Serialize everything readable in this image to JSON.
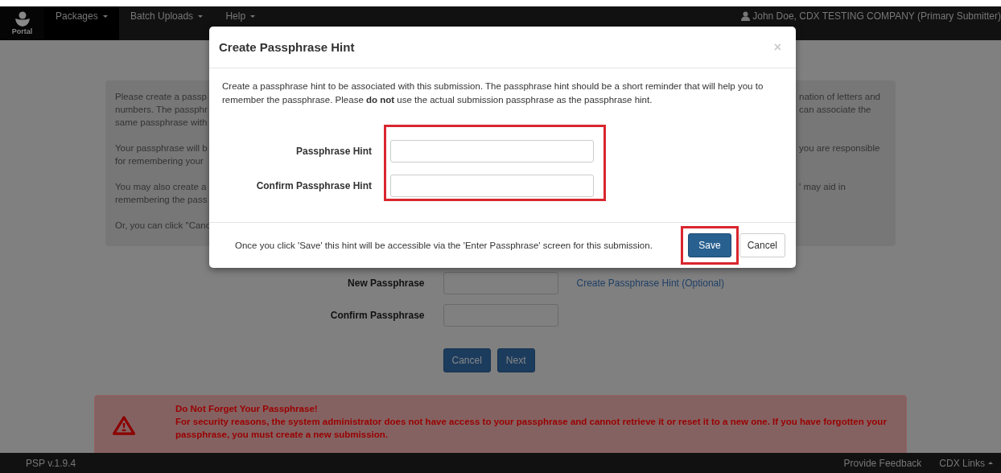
{
  "navbar": {
    "logo_text": "Portal",
    "menus": [
      {
        "label": "Packages",
        "selected": true
      },
      {
        "label": "Batch Uploads",
        "selected": false
      },
      {
        "label": "Help",
        "selected": false
      }
    ],
    "user": "John Doe, CDX TESTING COMPANY (Primary Submitter)"
  },
  "info_panel": {
    "paragraphs": [
      [
        {
          "left": "Please create a passp",
          "right": "nation of letters and"
        },
        {
          "left": "numbers. The passphr",
          "right": "can associate the"
        },
        {
          "left": "same passphrase with"
        }
      ],
      [
        {
          "left": "Your passphrase will b",
          "right": "you are responsible"
        },
        {
          "left": "for remembering your"
        }
      ],
      [
        {
          "left": "You may also create a",
          "right": "' may aid in"
        },
        {
          "left": "remembering the pass"
        }
      ],
      [
        {
          "left": "Or, you can click \"Canc"
        }
      ]
    ]
  },
  "form": {
    "fields": [
      {
        "label": "New Passphrase",
        "link": "Create Passphrase Hint (Optional)"
      },
      {
        "label": "Confirm Passphrase"
      }
    ],
    "buttons": [
      "Cancel",
      "Next"
    ]
  },
  "alert": {
    "title": "Do Not Forget Your Passphrase!",
    "text": "For security reasons, the system administrator does not have access to your passphrase and cannot retrieve it or reset it to a new one. If you have forgotten your passphrase, you must create a new submission."
  },
  "footer": {
    "version": "PSP v.1.9.4",
    "links": [
      {
        "label": "Provide Feedback",
        "caret": false
      },
      {
        "label": "CDX Links",
        "caret": true
      }
    ]
  },
  "modal": {
    "title": "Create Passphrase Hint",
    "close": "×",
    "intro": "Create a passphrase hint to be associated with this submission. The passphrase hint should be a short reminder that will help you to remember the passphrase. Please **do not** use the actual submission passphrase as the passphrase hint.",
    "fields_highlighted": true,
    "fields": [
      {
        "label": "Passphrase Hint"
      },
      {
        "label": "Confirm Passphrase Hint"
      }
    ],
    "note": "Once you click 'Save' this hint will be accessible via the 'Enter Passphrase' screen for this submission.",
    "buttons": [
      {
        "label": "Save",
        "kind": "primary",
        "highlighted": true
      },
      {
        "label": "Cancel",
        "kind": "default",
        "highlighted": false
      }
    ]
  }
}
